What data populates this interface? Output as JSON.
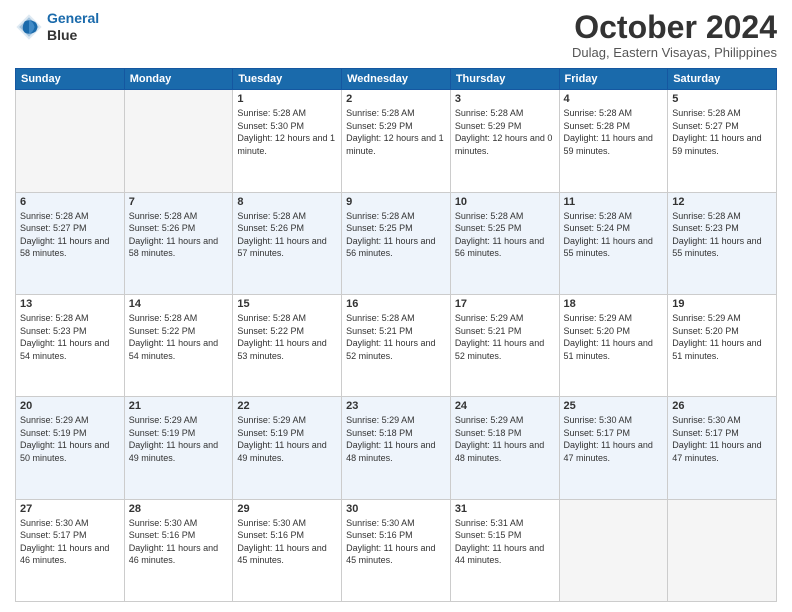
{
  "header": {
    "logo_line1": "General",
    "logo_line2": "Blue",
    "month": "October 2024",
    "location": "Dulag, Eastern Visayas, Philippines"
  },
  "days_of_week": [
    "Sunday",
    "Monday",
    "Tuesday",
    "Wednesday",
    "Thursday",
    "Friday",
    "Saturday"
  ],
  "weeks": [
    [
      {
        "day": "",
        "sunrise": "",
        "sunset": "",
        "daylight": ""
      },
      {
        "day": "",
        "sunrise": "",
        "sunset": "",
        "daylight": ""
      },
      {
        "day": "1",
        "sunrise": "Sunrise: 5:28 AM",
        "sunset": "Sunset: 5:30 PM",
        "daylight": "Daylight: 12 hours and 1 minute."
      },
      {
        "day": "2",
        "sunrise": "Sunrise: 5:28 AM",
        "sunset": "Sunset: 5:29 PM",
        "daylight": "Daylight: 12 hours and 1 minute."
      },
      {
        "day": "3",
        "sunrise": "Sunrise: 5:28 AM",
        "sunset": "Sunset: 5:29 PM",
        "daylight": "Daylight: 12 hours and 0 minutes."
      },
      {
        "day": "4",
        "sunrise": "Sunrise: 5:28 AM",
        "sunset": "Sunset: 5:28 PM",
        "daylight": "Daylight: 11 hours and 59 minutes."
      },
      {
        "day": "5",
        "sunrise": "Sunrise: 5:28 AM",
        "sunset": "Sunset: 5:27 PM",
        "daylight": "Daylight: 11 hours and 59 minutes."
      }
    ],
    [
      {
        "day": "6",
        "sunrise": "Sunrise: 5:28 AM",
        "sunset": "Sunset: 5:27 PM",
        "daylight": "Daylight: 11 hours and 58 minutes."
      },
      {
        "day": "7",
        "sunrise": "Sunrise: 5:28 AM",
        "sunset": "Sunset: 5:26 PM",
        "daylight": "Daylight: 11 hours and 58 minutes."
      },
      {
        "day": "8",
        "sunrise": "Sunrise: 5:28 AM",
        "sunset": "Sunset: 5:26 PM",
        "daylight": "Daylight: 11 hours and 57 minutes."
      },
      {
        "day": "9",
        "sunrise": "Sunrise: 5:28 AM",
        "sunset": "Sunset: 5:25 PM",
        "daylight": "Daylight: 11 hours and 56 minutes."
      },
      {
        "day": "10",
        "sunrise": "Sunrise: 5:28 AM",
        "sunset": "Sunset: 5:25 PM",
        "daylight": "Daylight: 11 hours and 56 minutes."
      },
      {
        "day": "11",
        "sunrise": "Sunrise: 5:28 AM",
        "sunset": "Sunset: 5:24 PM",
        "daylight": "Daylight: 11 hours and 55 minutes."
      },
      {
        "day": "12",
        "sunrise": "Sunrise: 5:28 AM",
        "sunset": "Sunset: 5:23 PM",
        "daylight": "Daylight: 11 hours and 55 minutes."
      }
    ],
    [
      {
        "day": "13",
        "sunrise": "Sunrise: 5:28 AM",
        "sunset": "Sunset: 5:23 PM",
        "daylight": "Daylight: 11 hours and 54 minutes."
      },
      {
        "day": "14",
        "sunrise": "Sunrise: 5:28 AM",
        "sunset": "Sunset: 5:22 PM",
        "daylight": "Daylight: 11 hours and 54 minutes."
      },
      {
        "day": "15",
        "sunrise": "Sunrise: 5:28 AM",
        "sunset": "Sunset: 5:22 PM",
        "daylight": "Daylight: 11 hours and 53 minutes."
      },
      {
        "day": "16",
        "sunrise": "Sunrise: 5:28 AM",
        "sunset": "Sunset: 5:21 PM",
        "daylight": "Daylight: 11 hours and 52 minutes."
      },
      {
        "day": "17",
        "sunrise": "Sunrise: 5:29 AM",
        "sunset": "Sunset: 5:21 PM",
        "daylight": "Daylight: 11 hours and 52 minutes."
      },
      {
        "day": "18",
        "sunrise": "Sunrise: 5:29 AM",
        "sunset": "Sunset: 5:20 PM",
        "daylight": "Daylight: 11 hours and 51 minutes."
      },
      {
        "day": "19",
        "sunrise": "Sunrise: 5:29 AM",
        "sunset": "Sunset: 5:20 PM",
        "daylight": "Daylight: 11 hours and 51 minutes."
      }
    ],
    [
      {
        "day": "20",
        "sunrise": "Sunrise: 5:29 AM",
        "sunset": "Sunset: 5:19 PM",
        "daylight": "Daylight: 11 hours and 50 minutes."
      },
      {
        "day": "21",
        "sunrise": "Sunrise: 5:29 AM",
        "sunset": "Sunset: 5:19 PM",
        "daylight": "Daylight: 11 hours and 49 minutes."
      },
      {
        "day": "22",
        "sunrise": "Sunrise: 5:29 AM",
        "sunset": "Sunset: 5:19 PM",
        "daylight": "Daylight: 11 hours and 49 minutes."
      },
      {
        "day": "23",
        "sunrise": "Sunrise: 5:29 AM",
        "sunset": "Sunset: 5:18 PM",
        "daylight": "Daylight: 11 hours and 48 minutes."
      },
      {
        "day": "24",
        "sunrise": "Sunrise: 5:29 AM",
        "sunset": "Sunset: 5:18 PM",
        "daylight": "Daylight: 11 hours and 48 minutes."
      },
      {
        "day": "25",
        "sunrise": "Sunrise: 5:30 AM",
        "sunset": "Sunset: 5:17 PM",
        "daylight": "Daylight: 11 hours and 47 minutes."
      },
      {
        "day": "26",
        "sunrise": "Sunrise: 5:30 AM",
        "sunset": "Sunset: 5:17 PM",
        "daylight": "Daylight: 11 hours and 47 minutes."
      }
    ],
    [
      {
        "day": "27",
        "sunrise": "Sunrise: 5:30 AM",
        "sunset": "Sunset: 5:17 PM",
        "daylight": "Daylight: 11 hours and 46 minutes."
      },
      {
        "day": "28",
        "sunrise": "Sunrise: 5:30 AM",
        "sunset": "Sunset: 5:16 PM",
        "daylight": "Daylight: 11 hours and 46 minutes."
      },
      {
        "day": "29",
        "sunrise": "Sunrise: 5:30 AM",
        "sunset": "Sunset: 5:16 PM",
        "daylight": "Daylight: 11 hours and 45 minutes."
      },
      {
        "day": "30",
        "sunrise": "Sunrise: 5:30 AM",
        "sunset": "Sunset: 5:16 PM",
        "daylight": "Daylight: 11 hours and 45 minutes."
      },
      {
        "day": "31",
        "sunrise": "Sunrise: 5:31 AM",
        "sunset": "Sunset: 5:15 PM",
        "daylight": "Daylight: 11 hours and 44 minutes."
      },
      {
        "day": "",
        "sunrise": "",
        "sunset": "",
        "daylight": ""
      },
      {
        "day": "",
        "sunrise": "",
        "sunset": "",
        "daylight": ""
      }
    ]
  ]
}
